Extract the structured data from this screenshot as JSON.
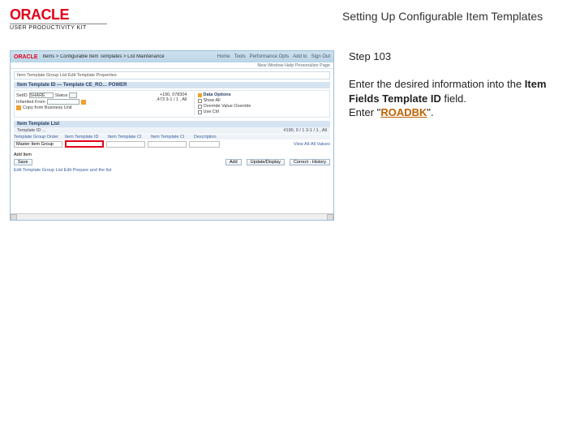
{
  "branding": {
    "oracle": "ORACLE",
    "upk": "USER PRODUCTIVITY KIT"
  },
  "title": "Setting Up Configurable Item Templates",
  "step_label": "Step 103",
  "instruction": {
    "line1_prefix": "Enter the desired information into the ",
    "field_name": "Item Fields Template ID",
    "line1_suffix": " field.",
    "line2_prefix": "Enter \"",
    "entry_value": "ROADBK",
    "line2_suffix": "\"."
  },
  "app": {
    "crumbs": "Items > Configurable Item Templates > List Maintenance",
    "top_links": [
      "Home",
      "Tools",
      "Performance Opts",
      "Add to",
      "Sign Out"
    ],
    "secondary": "New Window   Help   Personalize Page",
    "breadcrumb_box": "Item Template Group List    Edit Template Properties",
    "section_header": "Item Template ID — Template CE_RO… POWER",
    "form_left_label1": "SetID",
    "form_left_label2": "Inherited From",
    "form_left_input": "SHARE",
    "form_left_label3": "Status",
    "form_left_label4": "Copy from Business Unit",
    "data_options_header": "Data Options",
    "data_opt1": "Show All",
    "data_opt2": "Override Value Override",
    "data_opt3": "Use Ctrl",
    "nums": "+190, 078304    ,473    3-1 / 1    , All",
    "list_section": "Item Template List",
    "list_meta_left": "Template ID ...",
    "list_meta_right": "#190, 0 / 1    3-1 / 1    , All",
    "col_labels": [
      "Template Group Order",
      "Item Template ID",
      "Item Template Cl",
      "Item Template Cl",
      "Description",
      "-"
    ],
    "row_group": "Master Item Group",
    "row_view": "View All-All Values",
    "addl_header": "Add Item",
    "addl_btns": [
      "Save",
      "Add",
      "Update/Display",
      "Correct - History"
    ],
    "footer_link": "Edit Template Group List   Edit   Prepare  and the list"
  }
}
